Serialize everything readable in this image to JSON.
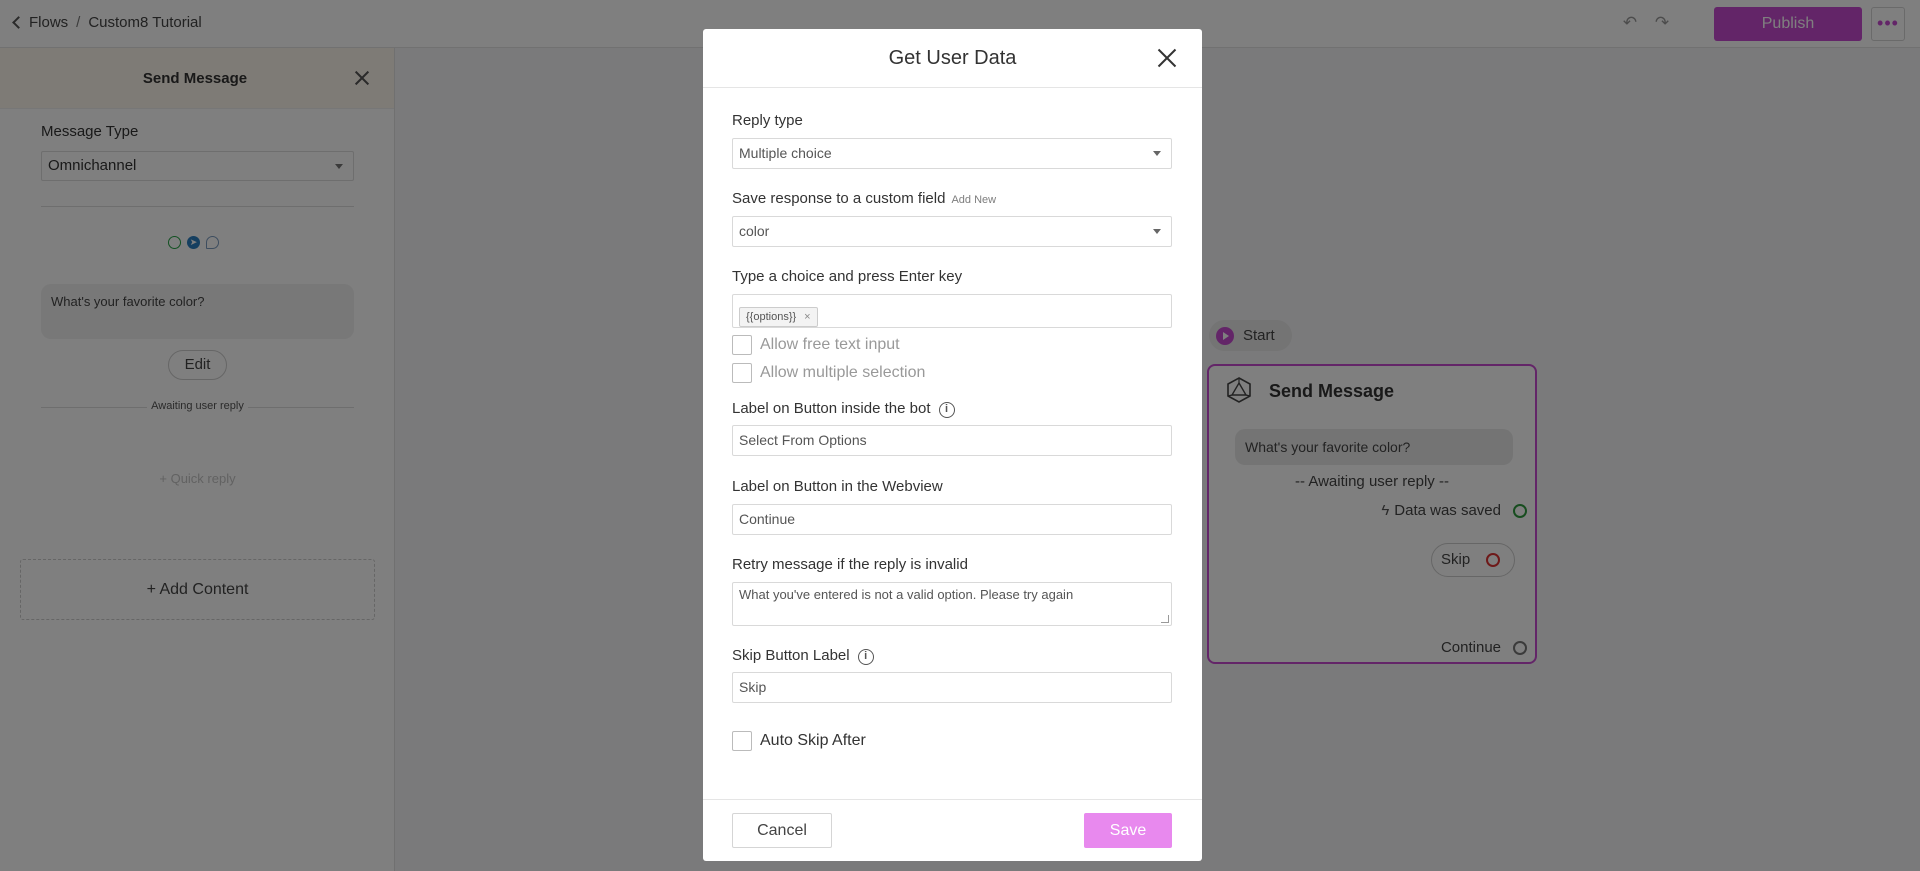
{
  "topbar": {
    "crumb_flows": "Flows",
    "crumb_sep": "/",
    "crumb_current": "Custom8 Tutorial",
    "publish_label": "Publish",
    "more_label": "•••",
    "undo_icon": "undo-icon",
    "redo_icon": "redo-icon"
  },
  "panel": {
    "title": "Send Message",
    "message_type_label": "Message Type",
    "message_type_value": "Omnichannel",
    "channels": [
      "whatsapp-icon",
      "telegram-icon",
      "messenger-icon"
    ],
    "message_text": "What's your favorite color?",
    "edit_label": "Edit",
    "awaiting_label": "Awaiting user reply",
    "quick_reply_label": "+ Quick reply",
    "add_content_label": "+  Add Content"
  },
  "canvas": {
    "start_label": "Start",
    "node": {
      "title": "Send Message",
      "message": "What's your favorite color?",
      "awaiting": "-- Awaiting user reply --",
      "data_saved": "Data was saved",
      "skip": "Skip",
      "continue": "Continue"
    }
  },
  "modal": {
    "title": "Get User Data",
    "reply_type_label": "Reply type",
    "reply_type_value": "Multiple choice",
    "save_field_label": "Save response to a custom field",
    "add_new_label": "Add New",
    "save_field_value": "color",
    "choice_label": "Type a choice and press Enter key",
    "choice_tag": "{{options}}",
    "choice_tag_remove": "×",
    "allow_free_text": "Allow free text input",
    "allow_multiple": "Allow multiple selection",
    "button_bot_label": "Label on Button inside the bot",
    "button_bot_value": "Select From Options",
    "button_webview_label": "Label on Button in the Webview",
    "button_webview_value": "Continue",
    "retry_label": "Retry message if the reply is invalid",
    "retry_value": "What you've entered is not a valid option. Please try again",
    "skip_label": "Skip Button Label",
    "skip_value": "Skip",
    "auto_skip_label": "Auto Skip After",
    "cancel_label": "Cancel",
    "save_label": "Save",
    "info_glyph": "i"
  },
  "colors": {
    "brand": "#c74ad1",
    "save_button": "#e889ee"
  }
}
